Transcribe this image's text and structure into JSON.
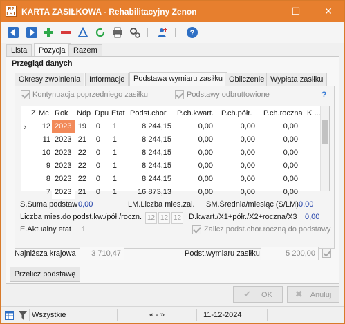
{
  "window": {
    "app_icon_text": "R2\nLST",
    "title": "KARTA ZASIŁKOWA - Rehabilitacyjny Zenon",
    "minimize_glyph": "—",
    "maximize_glyph": "☐",
    "close_glyph": "✕"
  },
  "main_tabs": [
    "Lista",
    "Pozycja",
    "Razem"
  ],
  "section_title": "Przegląd danych",
  "sub_tabs": [
    "Okresy zwolnienia",
    "Informacje",
    "Podstawa wymiaru zasiłku",
    "Obliczenie",
    "Wypłata zasiłku"
  ],
  "checkboxes": {
    "kontynuacja": "Kontynuacja poprzedniego zasiłku",
    "odbruttowione": "Podstawy odbruttowione",
    "help": "?"
  },
  "grid": {
    "columns": [
      "Z",
      "Mc",
      "Rok",
      "Ndp",
      "Dpu",
      "Etat",
      "Podst.chor.",
      "P.ch.kwart.",
      "P.ch.półr.",
      "P.ch.roczna",
      "K",
      "..."
    ],
    "current_row_marker": "›",
    "rows": [
      {
        "z": "",
        "mc": "12",
        "rok": "2023",
        "ndp": "19",
        "dpu": "0",
        "etat": "1",
        "podst": "8 244,15",
        "kwart": "0,00",
        "polr": "0,00",
        "roczna": "0,00"
      },
      {
        "z": "",
        "mc": "11",
        "rok": "2023",
        "ndp": "21",
        "dpu": "0",
        "etat": "1",
        "podst": "8 244,15",
        "kwart": "0,00",
        "polr": "0,00",
        "roczna": "0,00"
      },
      {
        "z": "",
        "mc": "10",
        "rok": "2023",
        "ndp": "22",
        "dpu": "0",
        "etat": "1",
        "podst": "8 244,15",
        "kwart": "0,00",
        "polr": "0,00",
        "roczna": "0,00"
      },
      {
        "z": "",
        "mc": "9",
        "rok": "2023",
        "ndp": "22",
        "dpu": "0",
        "etat": "1",
        "podst": "8 244,15",
        "kwart": "0,00",
        "polr": "0,00",
        "roczna": "0,00"
      },
      {
        "z": "",
        "mc": "8",
        "rok": "2023",
        "ndp": "22",
        "dpu": "0",
        "etat": "1",
        "podst": "8 244,15",
        "kwart": "0,00",
        "polr": "0,00",
        "roczna": "0,00"
      },
      {
        "z": "",
        "mc": "7",
        "rok": "2023",
        "ndp": "21",
        "dpu": "0",
        "etat": "1",
        "podst": "16 873,13",
        "kwart": "0,00",
        "polr": "0,00",
        "roczna": "0,00"
      }
    ]
  },
  "summary": {
    "suma_label": "S.Suma podstaw",
    "suma_value": "0,00",
    "lm_label": "LM.Liczba mies.zal.",
    "sm_label": "SM.Średnia/miesiąc (S/LM)",
    "sm_value": "0,00",
    "liczba_label": "Liczba mies.do podst.kw./pół./roczn.",
    "liczba_values": [
      "12",
      "12",
      "12"
    ],
    "dkwart_label": "D.kwart./X1+półr./X2+roczna/X3",
    "dkwart_value": "0,00",
    "etat_label": "E.Aktualny etat",
    "etat_value": "1",
    "zalicz_label": "Zalicz podst.chor.roczną do podstawy",
    "najnizsza_label": "Najniższa krajowa",
    "najnizsza_value": "3 710,47",
    "podst_wym_label": "Podst.wymiaru zasiłku",
    "podst_wym_value": "5 200,00",
    "przelicz_label": "Przelicz podstawę"
  },
  "dialog": {
    "ok_label": "OK",
    "cancel_label": "Anuluj"
  },
  "status": {
    "filter_text": "Wszystkie",
    "nav_text": "« - »",
    "date": "11-12-2024"
  },
  "colors": {
    "titlebar": "#e77f2e",
    "highlight_cell": "#f28a5a",
    "value_blue": "#1f3fa8",
    "selected_cell": "#fbe8de"
  }
}
